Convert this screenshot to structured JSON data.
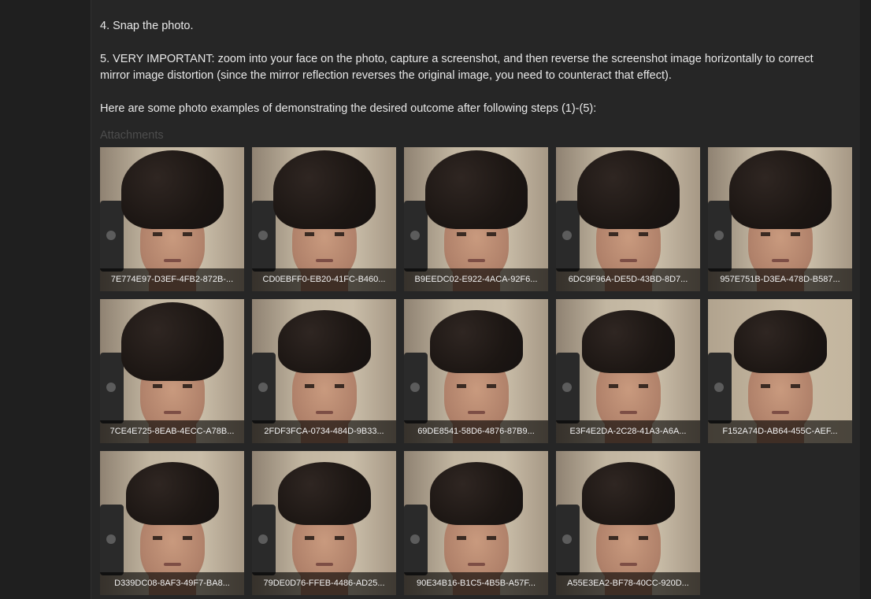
{
  "content": {
    "step4": "4. Snap the photo.",
    "step5_line1": "5. VERY IMPORTANT: zoom into your face on the photo, capture a screenshot, and then reverse the screenshot image horizontally to correct",
    "step5_line2": "mirror image distortion (since the mirror reflection reverses the original image, you need to counteract that effect).",
    "intro": "Here are some photo examples of demonstrating the desired outcome after following steps (1)-(5):",
    "attachments_label": "Attachments"
  },
  "attachments": [
    {
      "filename": "7E774E97-D3EF-4FB2-872B-..."
    },
    {
      "filename": "CD0EBFF0-EB20-41FC-B460..."
    },
    {
      "filename": "B9EEDC02-E922-4ACA-92F6..."
    },
    {
      "filename": "6DC9F96A-DE5D-43BD-8D7..."
    },
    {
      "filename": "957E751B-D3EA-478D-B587..."
    },
    {
      "filename": "7CE4E725-8EAB-4ECC-A78B..."
    },
    {
      "filename": "2FDF3FCA-0734-484D-9B33..."
    },
    {
      "filename": "69DE8541-58D6-4876-87B9..."
    },
    {
      "filename": "E3F4E2DA-2C28-41A3-A6A..."
    },
    {
      "filename": "F152A74D-AB64-455C-AEF..."
    },
    {
      "filename": "D339DC08-8AF3-49F7-BA8..."
    },
    {
      "filename": "79DE0D76-FFEB-4486-AD25..."
    },
    {
      "filename": "90E34B16-B1C5-4B5B-A57F..."
    },
    {
      "filename": "A55E3EA2-BF78-40CC-920D..."
    }
  ]
}
